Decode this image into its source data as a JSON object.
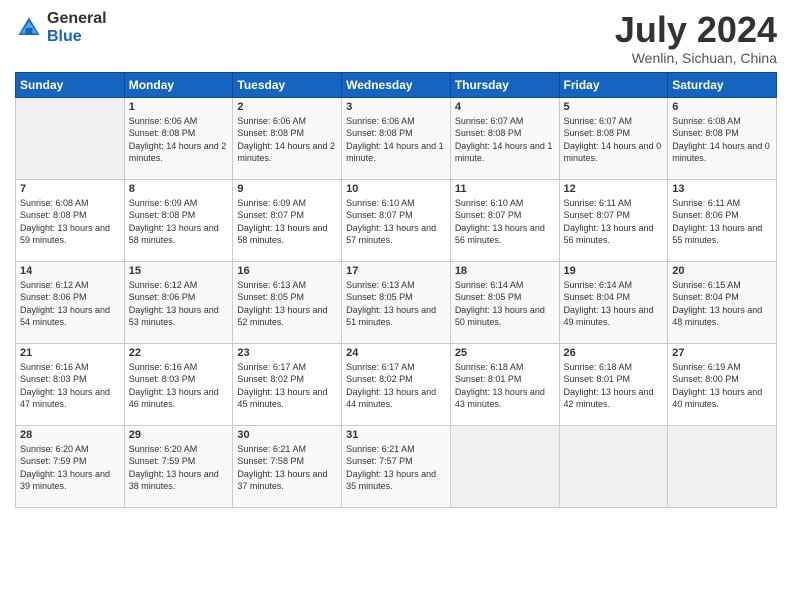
{
  "header": {
    "logo_general": "General",
    "logo_blue": "Blue",
    "title": "July 2024",
    "location": "Wenlin, Sichuan, China"
  },
  "days_of_week": [
    "Sunday",
    "Monday",
    "Tuesday",
    "Wednesday",
    "Thursday",
    "Friday",
    "Saturday"
  ],
  "weeks": [
    [
      {
        "day": "",
        "empty": true
      },
      {
        "day": "1",
        "sunrise": "6:06 AM",
        "sunset": "8:08 PM",
        "daylight": "14 hours and 2 minutes."
      },
      {
        "day": "2",
        "sunrise": "6:06 AM",
        "sunset": "8:08 PM",
        "daylight": "14 hours and 2 minutes."
      },
      {
        "day": "3",
        "sunrise": "6:06 AM",
        "sunset": "8:08 PM",
        "daylight": "14 hours and 1 minute."
      },
      {
        "day": "4",
        "sunrise": "6:07 AM",
        "sunset": "8:08 PM",
        "daylight": "14 hours and 1 minute."
      },
      {
        "day": "5",
        "sunrise": "6:07 AM",
        "sunset": "8:08 PM",
        "daylight": "14 hours and 0 minutes."
      },
      {
        "day": "6",
        "sunrise": "6:08 AM",
        "sunset": "8:08 PM",
        "daylight": "14 hours and 0 minutes."
      }
    ],
    [
      {
        "day": "7",
        "sunrise": "6:08 AM",
        "sunset": "8:08 PM",
        "daylight": "13 hours and 59 minutes."
      },
      {
        "day": "8",
        "sunrise": "6:09 AM",
        "sunset": "8:08 PM",
        "daylight": "13 hours and 58 minutes."
      },
      {
        "day": "9",
        "sunrise": "6:09 AM",
        "sunset": "8:07 PM",
        "daylight": "13 hours and 58 minutes."
      },
      {
        "day": "10",
        "sunrise": "6:10 AM",
        "sunset": "8:07 PM",
        "daylight": "13 hours and 57 minutes."
      },
      {
        "day": "11",
        "sunrise": "6:10 AM",
        "sunset": "8:07 PM",
        "daylight": "13 hours and 56 minutes."
      },
      {
        "day": "12",
        "sunrise": "6:11 AM",
        "sunset": "8:07 PM",
        "daylight": "13 hours and 56 minutes."
      },
      {
        "day": "13",
        "sunrise": "6:11 AM",
        "sunset": "8:06 PM",
        "daylight": "13 hours and 55 minutes."
      }
    ],
    [
      {
        "day": "14",
        "sunrise": "6:12 AM",
        "sunset": "8:06 PM",
        "daylight": "13 hours and 54 minutes."
      },
      {
        "day": "15",
        "sunrise": "6:12 AM",
        "sunset": "8:06 PM",
        "daylight": "13 hours and 53 minutes."
      },
      {
        "day": "16",
        "sunrise": "6:13 AM",
        "sunset": "8:05 PM",
        "daylight": "13 hours and 52 minutes."
      },
      {
        "day": "17",
        "sunrise": "6:13 AM",
        "sunset": "8:05 PM",
        "daylight": "13 hours and 51 minutes."
      },
      {
        "day": "18",
        "sunrise": "6:14 AM",
        "sunset": "8:05 PM",
        "daylight": "13 hours and 50 minutes."
      },
      {
        "day": "19",
        "sunrise": "6:14 AM",
        "sunset": "8:04 PM",
        "daylight": "13 hours and 49 minutes."
      },
      {
        "day": "20",
        "sunrise": "6:15 AM",
        "sunset": "8:04 PM",
        "daylight": "13 hours and 48 minutes."
      }
    ],
    [
      {
        "day": "21",
        "sunrise": "6:16 AM",
        "sunset": "8:03 PM",
        "daylight": "13 hours and 47 minutes."
      },
      {
        "day": "22",
        "sunrise": "6:16 AM",
        "sunset": "8:03 PM",
        "daylight": "13 hours and 46 minutes."
      },
      {
        "day": "23",
        "sunrise": "6:17 AM",
        "sunset": "8:02 PM",
        "daylight": "13 hours and 45 minutes."
      },
      {
        "day": "24",
        "sunrise": "6:17 AM",
        "sunset": "8:02 PM",
        "daylight": "13 hours and 44 minutes."
      },
      {
        "day": "25",
        "sunrise": "6:18 AM",
        "sunset": "8:01 PM",
        "daylight": "13 hours and 43 minutes."
      },
      {
        "day": "26",
        "sunrise": "6:18 AM",
        "sunset": "8:01 PM",
        "daylight": "13 hours and 42 minutes."
      },
      {
        "day": "27",
        "sunrise": "6:19 AM",
        "sunset": "8:00 PM",
        "daylight": "13 hours and 40 minutes."
      }
    ],
    [
      {
        "day": "28",
        "sunrise": "6:20 AM",
        "sunset": "7:59 PM",
        "daylight": "13 hours and 39 minutes."
      },
      {
        "day": "29",
        "sunrise": "6:20 AM",
        "sunset": "7:59 PM",
        "daylight": "13 hours and 38 minutes."
      },
      {
        "day": "30",
        "sunrise": "6:21 AM",
        "sunset": "7:58 PM",
        "daylight": "13 hours and 37 minutes."
      },
      {
        "day": "31",
        "sunrise": "6:21 AM",
        "sunset": "7:57 PM",
        "daylight": "13 hours and 35 minutes."
      },
      {
        "day": "",
        "empty": true
      },
      {
        "day": "",
        "empty": true
      },
      {
        "day": "",
        "empty": true
      }
    ]
  ],
  "labels": {
    "sunrise_prefix": "Sunrise: ",
    "sunset_prefix": "Sunset: ",
    "daylight_prefix": "Daylight: "
  }
}
